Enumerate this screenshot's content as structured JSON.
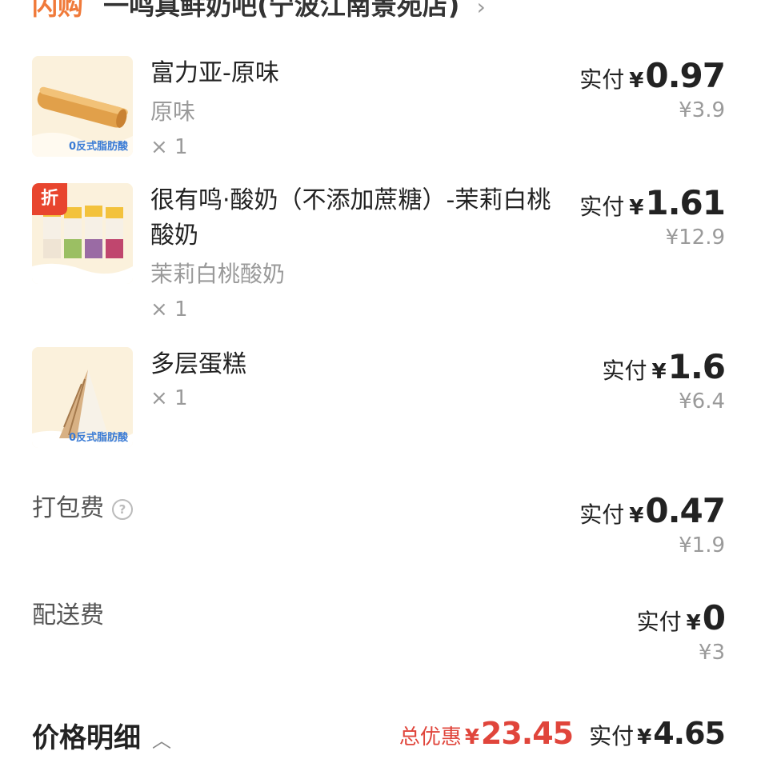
{
  "header": {
    "brand": "闪购",
    "store_name": "一鸣真鲜奶吧(宁波江南景苑店)",
    "chevron": "›"
  },
  "items": [
    {
      "name": "富力亚-原味",
      "spec": "原味",
      "qty": "× 1",
      "paid_label": "实付",
      "currency": "¥",
      "paid_amount": "0.97",
      "original_price": "¥3.9",
      "thumb_badge": "0反式脂肪酸"
    },
    {
      "name": "很有鸣·酸奶（不添加蔗糖）-茉莉白桃酸奶",
      "spec": "茉莉白桃酸奶",
      "qty": "× 1",
      "paid_label": "实付",
      "currency": "¥",
      "paid_amount": "1.61",
      "original_price": "¥12.9",
      "discount_badge": "折"
    },
    {
      "name": "多层蛋糕",
      "qty": "× 1",
      "paid_label": "实付",
      "currency": "¥",
      "paid_amount": "1.6",
      "original_price": "¥6.4",
      "thumb_badge": "0反式脂肪酸"
    }
  ],
  "fees": [
    {
      "label": "打包费",
      "help_icon": "question-circle-icon",
      "paid_label": "实付",
      "currency": "¥",
      "paid_amount": "0.47",
      "original_price": "¥1.9"
    },
    {
      "label": "配送费",
      "paid_label": "实付",
      "currency": "¥",
      "paid_amount": "0",
      "original_price": "¥3"
    }
  ],
  "summary": {
    "detail_label": "价格明细",
    "total_discount_label": "总优惠",
    "currency": "¥",
    "total_discount": "23.45",
    "total_paid_label": "实付",
    "total_paid": "4.65"
  },
  "colors": {
    "discount_red": "#e0453b",
    "brand_orange": "#f07a3a"
  }
}
